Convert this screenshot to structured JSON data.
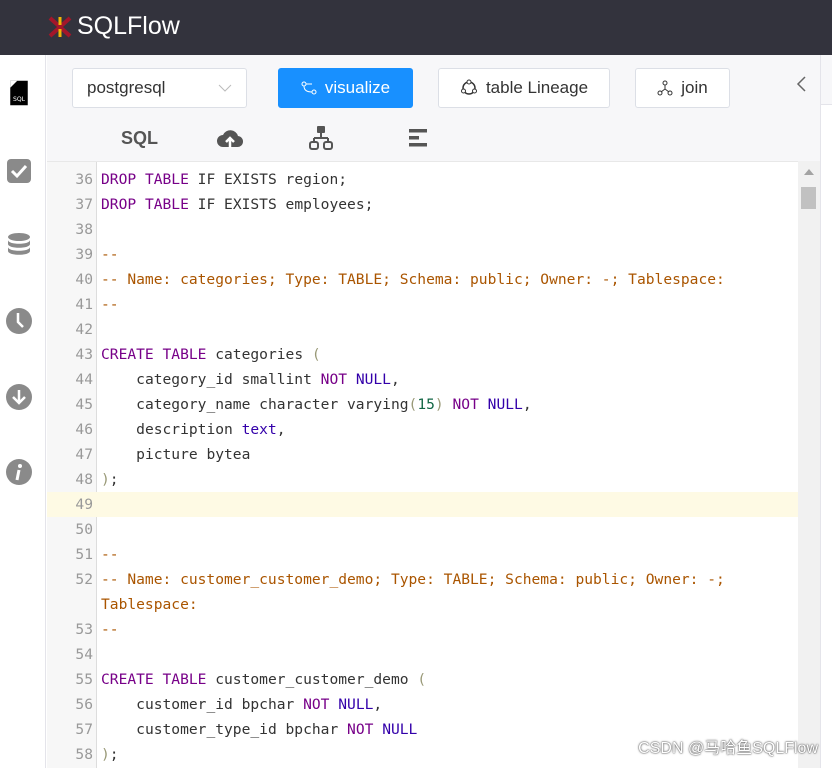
{
  "app": {
    "title": "SQLFlow"
  },
  "toolbar": {
    "dialect": "postgresql",
    "visualize": "visualize",
    "table_lineage": "table Lineage",
    "join": "join",
    "sql_tab": "SQL"
  },
  "sidebar": {
    "items": [
      "sql-file",
      "check",
      "database",
      "history",
      "download",
      "info"
    ]
  },
  "colors": {
    "accent": "#1890ff",
    "keyword": "#770088",
    "comment": "#aa5500",
    "type": "#3300aa",
    "number": "#116644",
    "header": "#33333d"
  },
  "editor": {
    "active_line": 49,
    "lines": [
      {
        "n": "36",
        "t": [
          [
            "kw",
            "DROP"
          ],
          [
            "",
            " "
          ],
          [
            "kw",
            "TABLE"
          ],
          [
            "",
            " IF EXISTS region;"
          ]
        ]
      },
      {
        "n": "37",
        "t": [
          [
            "kw",
            "DROP"
          ],
          [
            "",
            " "
          ],
          [
            "kw",
            "TABLE"
          ],
          [
            "",
            " IF EXISTS employees;"
          ]
        ]
      },
      {
        "n": "38",
        "t": []
      },
      {
        "n": "39",
        "t": [
          [
            "cm",
            "--"
          ]
        ]
      },
      {
        "n": "40",
        "t": [
          [
            "cm",
            "-- Name: categories; Type: TABLE; Schema: public; Owner: -; Tablespace:"
          ]
        ]
      },
      {
        "n": "41",
        "t": [
          [
            "cm",
            "--"
          ]
        ]
      },
      {
        "n": "42",
        "t": []
      },
      {
        "n": "43",
        "t": [
          [
            "kw",
            "CREATE"
          ],
          [
            "",
            " "
          ],
          [
            "kw",
            "TABLE"
          ],
          [
            "",
            " categories "
          ],
          [
            "br",
            "("
          ]
        ]
      },
      {
        "n": "44",
        "t": [
          [
            "",
            "    category_id smallint "
          ],
          [
            "kw",
            "NOT"
          ],
          [
            "",
            " "
          ],
          [
            "tp",
            "NULL"
          ],
          [
            "",
            ","
          ]
        ]
      },
      {
        "n": "45",
        "t": [
          [
            "",
            "    category_name character varying"
          ],
          [
            "br",
            "("
          ],
          [
            "nm",
            "15"
          ],
          [
            "br",
            ")"
          ],
          [
            "",
            " "
          ],
          [
            "kw",
            "NOT"
          ],
          [
            "",
            " "
          ],
          [
            "tp",
            "NULL"
          ],
          [
            "",
            ","
          ]
        ]
      },
      {
        "n": "46",
        "t": [
          [
            "",
            "    description "
          ],
          [
            "tp",
            "text"
          ],
          [
            "",
            ","
          ]
        ]
      },
      {
        "n": "47",
        "t": [
          [
            "",
            "    picture bytea"
          ]
        ]
      },
      {
        "n": "48",
        "t": [
          [
            "br",
            ")"
          ],
          [
            "",
            ";"
          ]
        ]
      },
      {
        "n": "49",
        "t": []
      },
      {
        "n": "50",
        "t": []
      },
      {
        "n": "51",
        "t": [
          [
            "cm",
            "--"
          ]
        ]
      },
      {
        "n": "52",
        "t": [
          [
            "cm",
            "-- Name: customer_customer_demo; Type: TABLE; Schema: public; Owner: -; Tablespace:"
          ]
        ]
      },
      {
        "n": "53",
        "t": [
          [
            "cm",
            "--"
          ]
        ]
      },
      {
        "n": "54",
        "t": []
      },
      {
        "n": "55",
        "t": [
          [
            "kw",
            "CREATE"
          ],
          [
            "",
            " "
          ],
          [
            "kw",
            "TABLE"
          ],
          [
            "",
            " customer_customer_demo "
          ],
          [
            "br",
            "("
          ]
        ]
      },
      {
        "n": "56",
        "t": [
          [
            "",
            "    customer_id bpchar "
          ],
          [
            "kw",
            "NOT"
          ],
          [
            "",
            " "
          ],
          [
            "tp",
            "NULL"
          ],
          [
            "",
            ","
          ]
        ]
      },
      {
        "n": "57",
        "t": [
          [
            "",
            "    customer_type_id bpchar "
          ],
          [
            "kw",
            "NOT"
          ],
          [
            "",
            " "
          ],
          [
            "tp",
            "NULL"
          ]
        ]
      },
      {
        "n": "58",
        "t": [
          [
            "br",
            ")"
          ],
          [
            "",
            ";"
          ]
        ]
      }
    ]
  },
  "watermark": "CSDN @马哈鱼SQLFlow"
}
